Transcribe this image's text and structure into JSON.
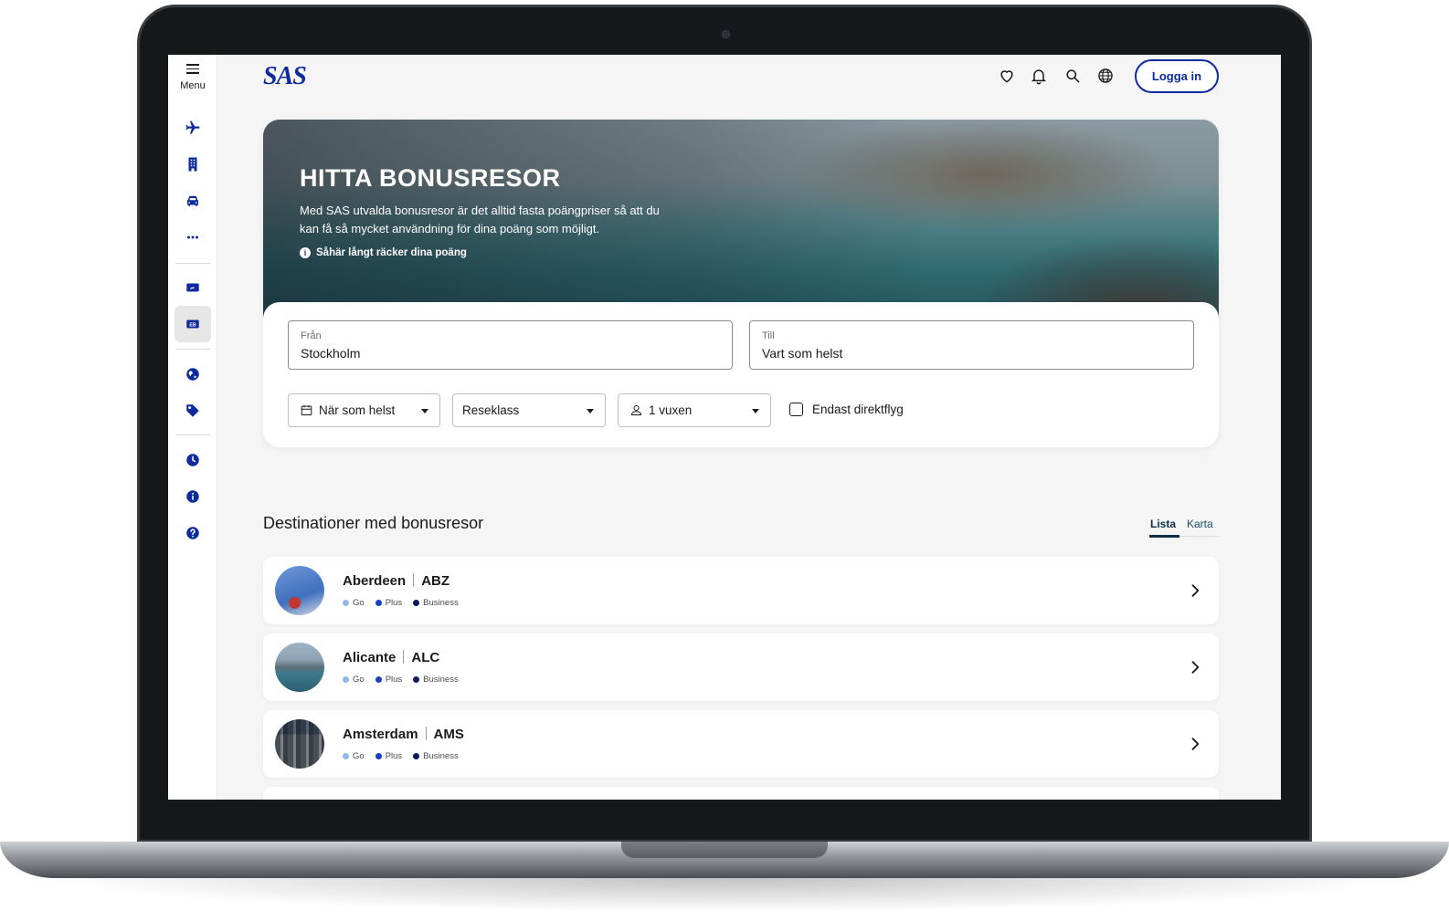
{
  "sidebar": {
    "menu_label": "Menu",
    "icons": [
      "plane-icon",
      "hotel-icon",
      "car-icon",
      "more-icon",
      "ticket-icon",
      "eurobonus-icon",
      "globe-icon",
      "tag-icon",
      "clock-icon",
      "info-icon",
      "help-icon"
    ],
    "eurobonus_label": "EB"
  },
  "header": {
    "logo_text": "SAS",
    "login_label": "Logga in",
    "icons": [
      "heart-icon",
      "bell-icon",
      "search-icon",
      "globe-icon"
    ]
  },
  "hero": {
    "title": "HITTA BONUSRESOR",
    "description": "Med SAS utvalda bonusresor är det alltid fasta poängpriser så att du kan få så mycket användning för dina poäng som möjligt.",
    "link": "Såhär långt räcker dina poäng"
  },
  "search": {
    "from_label": "Från",
    "from_value": "Stockholm",
    "to_label": "Till",
    "to_value": "Vart som helst",
    "date_value": "När som helst",
    "class_value": "Reseklass",
    "passengers_value": "1 vuxen",
    "direct_only_label": "Endast direktflyg"
  },
  "destinations": {
    "title": "Destinationer med bonusresor",
    "tabs": [
      "Lista",
      "Karta"
    ],
    "class_labels": [
      "Go",
      "Plus",
      "Business"
    ],
    "items": [
      {
        "city": "Aberdeen",
        "code": "ABZ"
      },
      {
        "city": "Alicante",
        "code": "ALC"
      },
      {
        "city": "Amsterdam",
        "code": "AMS"
      }
    ]
  },
  "colors": {
    "brand_blue": "#0d2b9c",
    "go": "#8fb7e8",
    "plus": "#1a3fc4",
    "business": "#0a1a5c"
  }
}
